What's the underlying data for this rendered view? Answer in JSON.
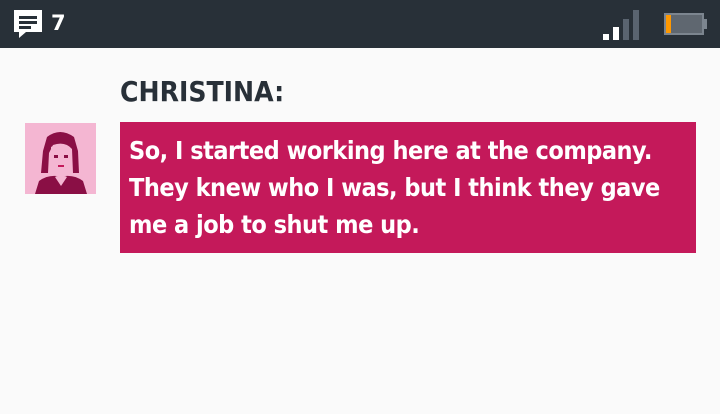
{
  "status_bar": {
    "message_icon": "message-icon",
    "message_count": "7",
    "signal_icon": "signal-strength-icon",
    "signal_level": 0.5,
    "battery_icon": "battery-icon",
    "battery_level": 0.15,
    "battery_color": "#ff9800"
  },
  "dialogue": {
    "speaker": "CHRISTINA:",
    "text": "So, I started working here at the company. They knew who I was, but I think they gave me a job to shut me up.",
    "portrait": "christina-portrait",
    "bubble_color": "#c4195a",
    "portrait_bg_color": "#f4b6d2"
  }
}
